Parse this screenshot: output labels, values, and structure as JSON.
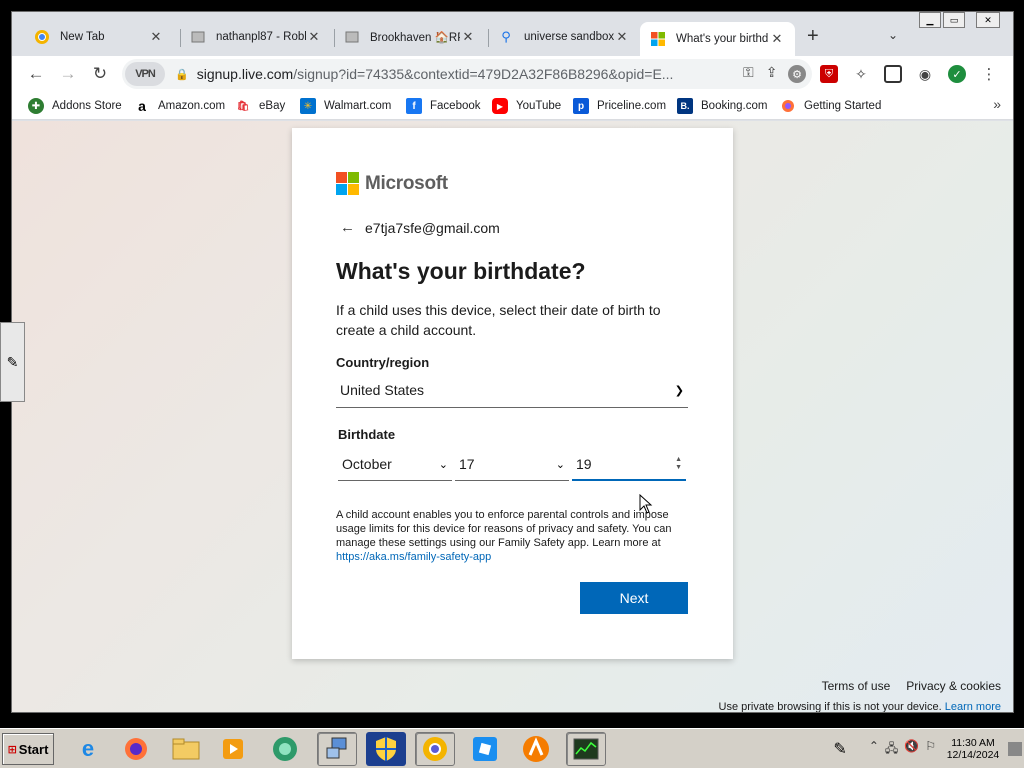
{
  "browser": {
    "tabs": [
      {
        "title": "New Tab",
        "icon": "chrome-icon",
        "active": false
      },
      {
        "title": "nathanpl87 - Roblo",
        "icon": "roblox-icon",
        "active": false
      },
      {
        "title": "Brookhaven 🏠RP",
        "icon": "roblox-icon",
        "active": false
      },
      {
        "title": "universe sandbox",
        "icon": "search-icon",
        "active": false
      },
      {
        "title": "What's your birthd",
        "icon": "microsoft-icon",
        "active": true
      }
    ],
    "vpn_label": "VPN",
    "url_host": "signup.live.com",
    "url_path": "/signup?id=74335&contextid=479D2A32F86B8296&opid=E...",
    "bookmarks": [
      {
        "label": "Addons Store",
        "color": "#2e7d32",
        "glyph": "✚"
      },
      {
        "label": "Amazon.com",
        "color": "#000000",
        "glyph": "a"
      },
      {
        "label": "eBay",
        "color": "#e53238",
        "glyph": "🛍"
      },
      {
        "label": "Walmart.com",
        "color": "#0071ce",
        "glyph": "✳"
      },
      {
        "label": "Facebook",
        "color": "#1877f2",
        "glyph": "f"
      },
      {
        "label": "YouTube",
        "color": "#ff0000",
        "glyph": "▶"
      },
      {
        "label": "Priceline.com",
        "color": "#0a5ad8",
        "glyph": "p"
      },
      {
        "label": "Booking.com",
        "color": "#003580",
        "glyph": "B."
      },
      {
        "label": "Getting Started",
        "color": "#ff7139",
        "glyph": "●"
      }
    ]
  },
  "signup": {
    "brand": "Microsoft",
    "email": "e7tja7sfe@gmail.com",
    "heading": "What's your birthdate?",
    "description": "If a child uses this device, select their date of birth to create a child account.",
    "country_label": "Country/region",
    "country_value": "United States",
    "birthdate_label": "Birthdate",
    "month_value": "October",
    "day_value": "17",
    "year_value": "19",
    "fine_print": "A child account enables you to enforce parental controls and impose usage limits for this device for reasons of privacy and safety. You can manage these settings using our Family Safety app. Learn more at",
    "fine_link": "https://aka.ms/family-safety-app",
    "next_label": "Next",
    "colors": {
      "accent": "#0067b8",
      "ms_red": "#f25022",
      "ms_green": "#7fba00",
      "ms_blue": "#00a4ef",
      "ms_yellow": "#ffb900"
    }
  },
  "footer": {
    "terms": "Terms of use",
    "privacy": "Privacy & cookies",
    "note": "Use private browsing if this is not your device.",
    "learn_more": "Learn more"
  },
  "taskbar": {
    "start_label": "Start",
    "clock_time": "11:30 AM",
    "clock_date": "12/14/2024"
  }
}
